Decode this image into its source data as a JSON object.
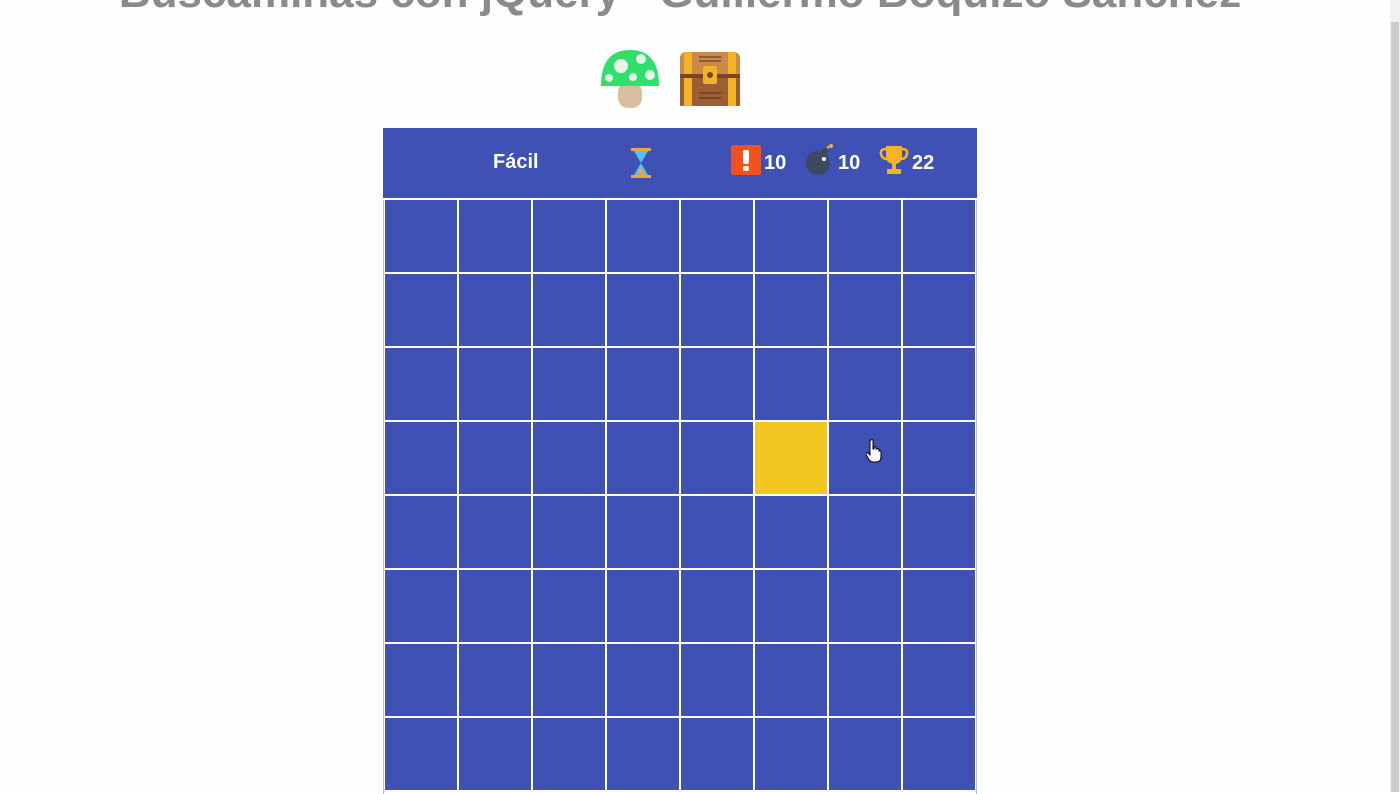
{
  "page": {
    "title": "Buscaminas con jQuery - Guillermo Boquizo Sánchez"
  },
  "toolbar": {
    "icons": [
      {
        "name": "mushroom-icon",
        "color": "#2ee06a"
      },
      {
        "name": "treasure-chest-icon",
        "color": "#b8743a"
      }
    ]
  },
  "header": {
    "difficulty": "Fácil",
    "timer_icon": "hourglass-icon",
    "flags": "10",
    "bombs": "10",
    "trophy": "22",
    "background": "#3f51b5"
  },
  "board": {
    "rows": 8,
    "cols": 8,
    "cell_color": "#3f51b5",
    "selected_color": "#f3c71f",
    "selected_cell": {
      "row": 4,
      "col": 6
    }
  }
}
